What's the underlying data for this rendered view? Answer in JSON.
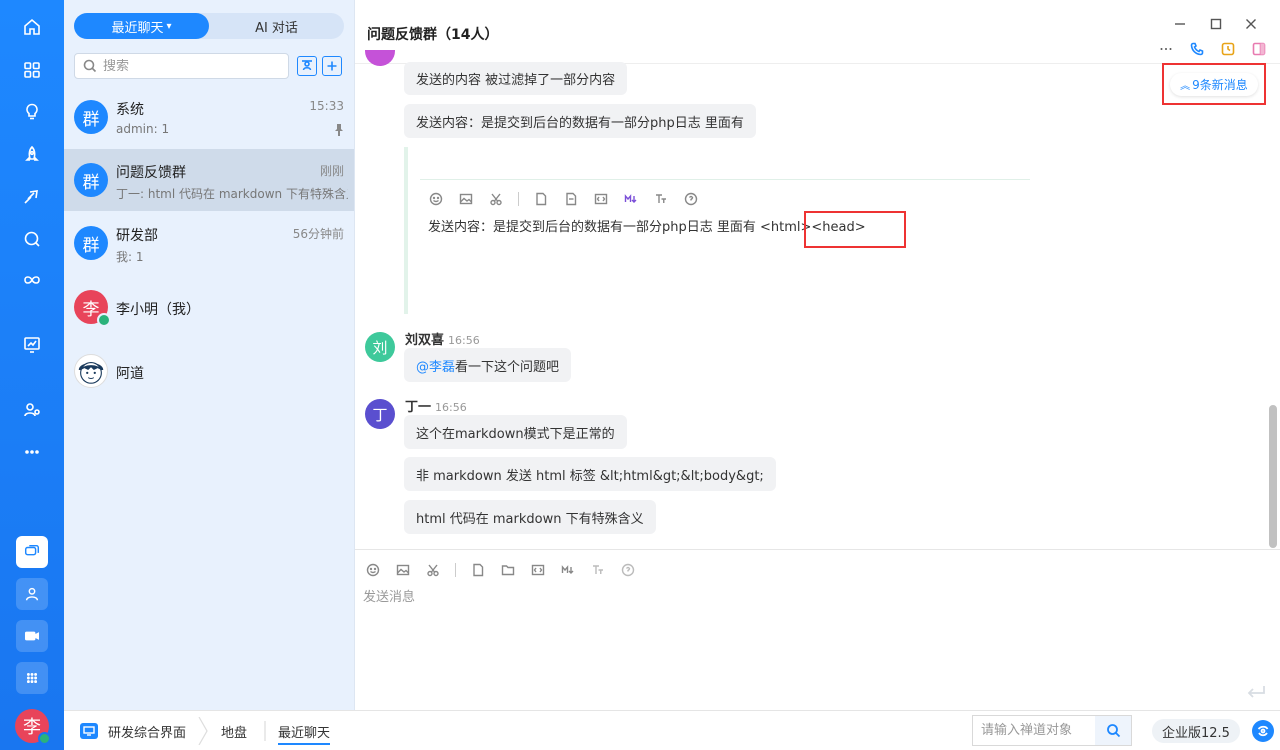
{
  "sidebar": {
    "tabs": {
      "recent_label": "最近聊天",
      "ai_label": "AI 对话"
    },
    "search_placeholder": "搜索",
    "conversations": [
      {
        "avatar": "群",
        "name": "系统",
        "time": "15:33",
        "preview": "admin: 1",
        "pinned": true
      },
      {
        "avatar": "群",
        "name": "问题反馈群",
        "time": "刚刚",
        "preview": "丁一: html 代码在 markdown 下有特殊含义",
        "active": true
      },
      {
        "avatar": "群",
        "name": "研发部",
        "time": "56分钟前",
        "preview": "我: 1"
      },
      {
        "avatar": "李",
        "name": "李小明（我）"
      },
      {
        "avatar": "",
        "name": "阿道"
      }
    ],
    "user_avatar": "李"
  },
  "chat": {
    "title": "问题反馈群（14人）",
    "new_messages": "9条新消息",
    "messages_top": [
      "发送的内容 被过滤掉了一部分内容",
      "发送内容：是提交到后台的数据有一部分php日志 里面有"
    ],
    "quote_text": "发送内容：是提交到后台的数据有一部分php日志 里面有 <html><head>",
    "msg_liu": {
      "avatar": "刘",
      "sender": "刘双喜",
      "time": "16:56",
      "mention": "@李磊",
      "text": " 看一下这个问题吧"
    },
    "msg_ding": {
      "avatar": "丁",
      "sender": "丁一",
      "time": "16:56",
      "bubbles": [
        "这个在markdown模式下是正常的",
        "非 markdown 发送 html 标签 &lt;html&gt;&lt;body&gt;",
        "html 代码在 markdown 下有特殊含义"
      ]
    },
    "composer_placeholder": "发送消息"
  },
  "statusbar": {
    "app_label": "研发综合界面",
    "crumb_map": "地盘",
    "crumb_recent": "最近聊天",
    "search_placeholder": "请输入禅道对象",
    "edition": "企业版12.5"
  },
  "colors": {
    "brand": "#1e88ff",
    "highlight_border": "#e33333",
    "avatar_liu": "#3ec99b",
    "avatar_ding": "#5a4fcf",
    "avatar_li": "#e8445a"
  }
}
